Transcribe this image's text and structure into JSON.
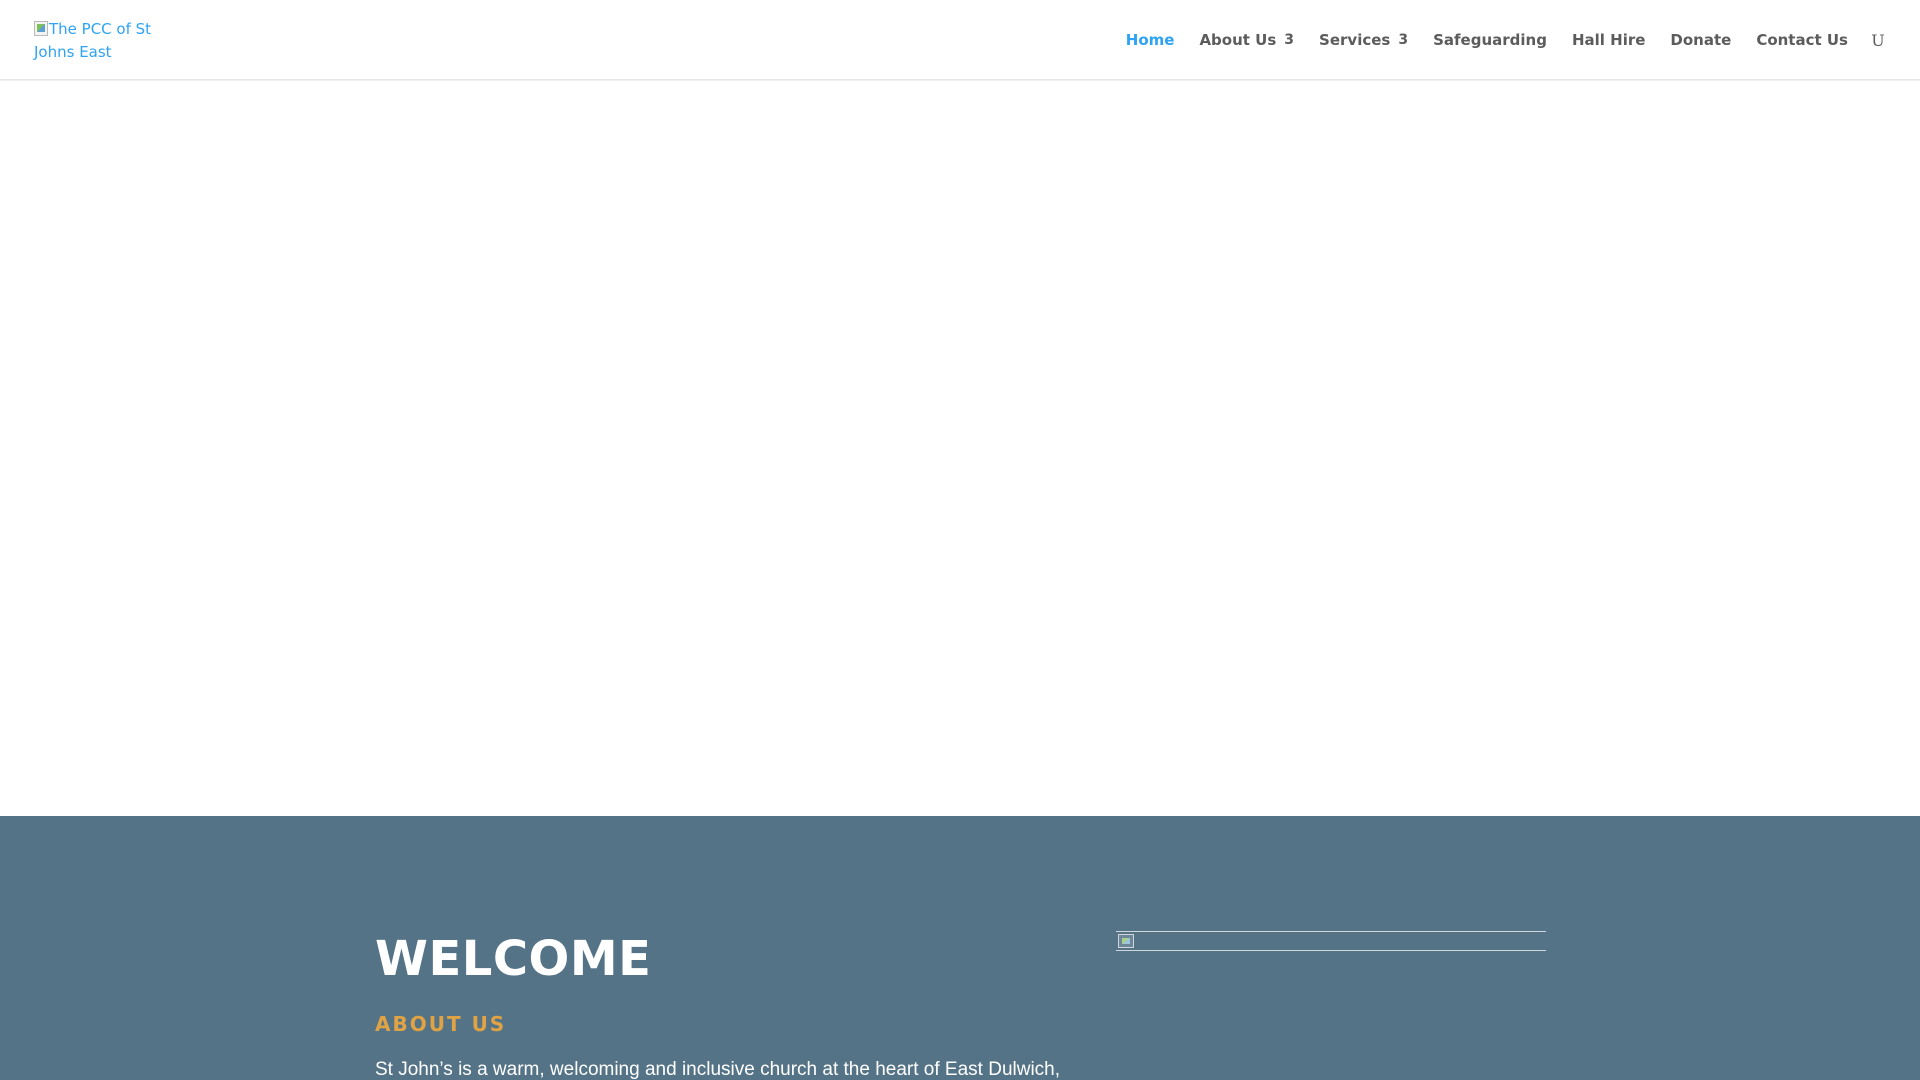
{
  "header": {
    "logo_alt": "The PCC of St Johns East",
    "nav": [
      {
        "label": "Home",
        "active": true,
        "has_dropdown": false
      },
      {
        "label": "About Us",
        "active": false,
        "has_dropdown": true
      },
      {
        "label": "Services",
        "active": false,
        "has_dropdown": true
      },
      {
        "label": "Safeguarding",
        "active": false,
        "has_dropdown": false
      },
      {
        "label": "Hall Hire",
        "active": false,
        "has_dropdown": false
      },
      {
        "label": "Donate",
        "active": false,
        "has_dropdown": false
      },
      {
        "label": "Contact Us",
        "active": false,
        "has_dropdown": false
      }
    ],
    "dropdown_glyph": "3",
    "search_glyph": "U",
    "search_icon": "search-icon"
  },
  "welcome": {
    "title": "WELCOME",
    "subtitle": "ABOUT US",
    "text": "St John’s is a warm, welcoming and inclusive church at the heart of East Dulwich,"
  },
  "colors": {
    "accent": "#2ea3f2",
    "nav_text": "#5c5c5c",
    "section_bg": "#557386",
    "subtitle": "#e0a344"
  }
}
